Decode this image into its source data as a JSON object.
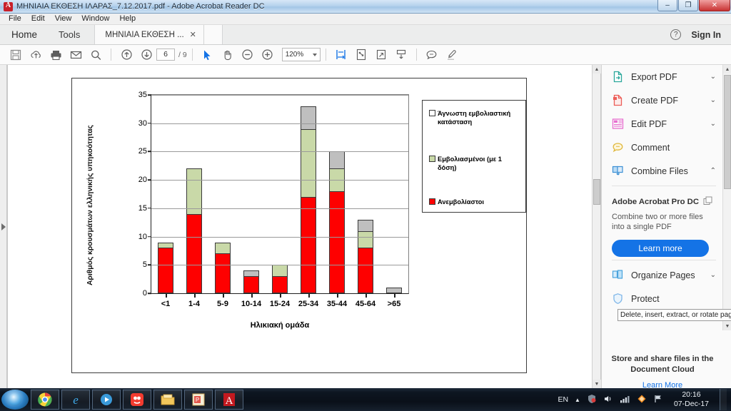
{
  "window": {
    "title": "ΜΗΝΙΑΙΑ ΕΚΘΕΣΗ ΙΛΑΡΑΣ_7.12.2017.pdf - Adobe Acrobat Reader DC",
    "app_icon": "acrobat-icon",
    "minimize": "–",
    "maximize": "❐",
    "close": "✕"
  },
  "menubar": {
    "items": [
      {
        "label": "File"
      },
      {
        "label": "Edit"
      },
      {
        "label": "View"
      },
      {
        "label": "Window"
      },
      {
        "label": "Help"
      }
    ]
  },
  "tabsbar": {
    "home": "Home",
    "tools": "Tools",
    "doc_tab": "ΜΗΝΙΑΙΑ ΕΚΘΕΣΗ ...",
    "doc_tab_close": "✕",
    "help_icon": "?",
    "sign_in": "Sign In"
  },
  "toolbar": {
    "icons": [
      {
        "name": "save-icon"
      },
      {
        "name": "upload-cloud-icon"
      },
      {
        "name": "print-icon"
      },
      {
        "name": "email-icon"
      },
      {
        "name": "search-icon"
      }
    ],
    "prev_page_icon": "up-arrow-icon",
    "next_page_icon": "down-arrow-icon",
    "page_number": "6",
    "page_total": "/ 9",
    "select_icon": "cursor-icon",
    "hand_icon": "hand-icon",
    "zoom_out_icon": "zoom-out-icon",
    "zoom_in_icon": "zoom-in-icon",
    "zoom_level": "120%",
    "fit_width_icon": "fit-width-icon",
    "page_thumb_icon": "page-snapshot-icon",
    "fullscreen_icon": "fullscreen-icon",
    "scroll_icon": "scroll-down-icon",
    "comment_icon": "comment-icon",
    "highlight_icon": "highlighter-icon"
  },
  "right_panel": {
    "items": [
      {
        "label": "Export PDF",
        "icon": "export-pdf-icon",
        "chevron": "⌄",
        "color": "#2aa79b"
      },
      {
        "label": "Create PDF",
        "icon": "create-pdf-icon",
        "chevron": "⌄",
        "color": "#ec5d57"
      },
      {
        "label": "Edit PDF",
        "icon": "edit-pdf-icon",
        "chevron": "⌄",
        "color": "#e86fd0"
      },
      {
        "label": "Comment",
        "icon": "comment-bubble-icon",
        "chevron": "",
        "color": "#efc84a"
      },
      {
        "label": "Combine Files",
        "icon": "combine-files-icon",
        "chevron": "⌃",
        "color": "#4a9fe0"
      }
    ],
    "promo": {
      "title": "Adobe Acrobat Pro DC",
      "title_icon": "stack-icon",
      "description": "Combine two or more files into a single PDF",
      "button": "Learn more"
    },
    "lower_items": [
      {
        "label": "Organize Pages",
        "icon": "organize-pages-icon",
        "chevron": "⌄",
        "color": "#57b5e0"
      },
      {
        "label": "Protect",
        "icon": "shield-icon",
        "chevron": "",
        "color": "#7fb6e8"
      }
    ],
    "tooltip": "Delete, insert, extract, or rotate pages",
    "cloud_promo": {
      "line1": "Store and share files in the",
      "line2": "Document Cloud",
      "link": "Learn More"
    }
  },
  "taskbar": {
    "start_icon": "windows-start-icon",
    "apps": [
      {
        "name": "chrome-icon"
      },
      {
        "name": "internet-explorer-icon"
      },
      {
        "name": "media-player-icon"
      },
      {
        "name": "gom-player-icon"
      },
      {
        "name": "file-explorer-icon"
      },
      {
        "name": "powerpoint-icon"
      },
      {
        "name": "acrobat-reader-icon"
      }
    ],
    "tray": {
      "language": "EN",
      "show_hidden_icon": "▲",
      "security-icon": "security-icon",
      "volume_icon": "volume-icon",
      "network_icon": "network-icon",
      "antivirus_icon": "antivirus-icon",
      "flag_icon": "action-center-icon"
    },
    "clock_time": "20:16",
    "clock_date": "07-Dec-17"
  },
  "chart_data": {
    "type": "bar",
    "title": "",
    "xlabel": "Ηλικιακή ομάδα",
    "ylabel": "Αριθμός κρουσμάτων ελληνικής υπηκοότητας",
    "categories": [
      "<1",
      "1-4",
      "5-9",
      "10-14",
      "15-24",
      "25-34",
      "35-44",
      "45-64",
      ">65"
    ],
    "ylim": [
      0,
      35
    ],
    "yticks": [
      0,
      5,
      10,
      15,
      20,
      25,
      30,
      35
    ],
    "grid": true,
    "stacked": true,
    "legend_position": "right",
    "series": [
      {
        "name": "Ανεμβολίαστοι",
        "color": "#fe0000",
        "values": [
          8,
          14,
          7,
          3,
          3,
          17,
          18,
          8,
          0
        ]
      },
      {
        "name": "Εμβολιασμένοι (με 1 δόση)",
        "color": "#c9d9a8",
        "values": [
          1,
          8,
          2,
          0,
          2,
          12,
          4,
          3,
          0
        ]
      },
      {
        "name": "Άγνωστη εμβολιαστική κατάσταση",
        "color": "#bfbfbf",
        "values": [
          0,
          0,
          0,
          1,
          0,
          4,
          3,
          2,
          1
        ]
      }
    ],
    "totals": [
      9,
      22,
      9,
      4,
      5,
      33,
      25,
      13,
      1
    ]
  }
}
